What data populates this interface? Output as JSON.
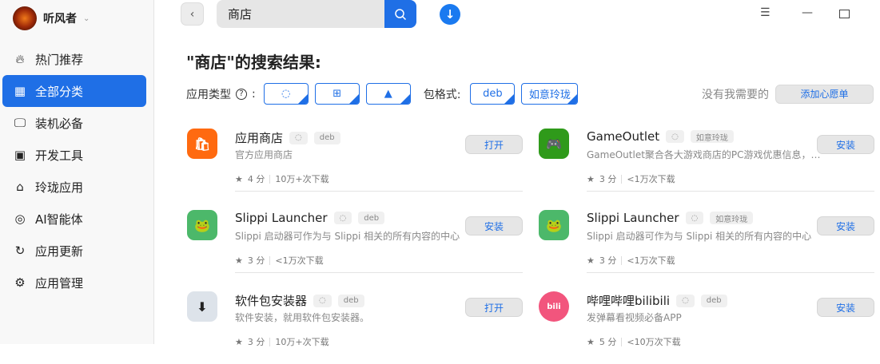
{
  "user": {
    "name": "听风者"
  },
  "sidebar": {
    "items": [
      {
        "label": "热门推荐",
        "icon": "fire-icon",
        "glyph": "🔥︎"
      },
      {
        "label": "全部分类",
        "icon": "grid-icon",
        "glyph": "▦",
        "active": true
      },
      {
        "label": "装机必备",
        "icon": "monitor-icon",
        "glyph": "🖵"
      },
      {
        "label": "开发工具",
        "icon": "terminal-icon",
        "glyph": "▣"
      },
      {
        "label": "玲珑应用",
        "icon": "linglong-icon",
        "glyph": "⌂"
      },
      {
        "label": "AI智能体",
        "icon": "ai-icon",
        "glyph": "◎"
      },
      {
        "label": "应用更新",
        "icon": "refresh-icon",
        "glyph": "↻"
      },
      {
        "label": "应用管理",
        "icon": "gear-icon",
        "glyph": "⚙"
      }
    ]
  },
  "search": {
    "value": "商店"
  },
  "heading": "\"商店\"的搜索结果:",
  "filters": {
    "type_label": "应用类型",
    "help": "?",
    "colon": ":",
    "format_label": "包格式:",
    "formats": [
      "deb",
      "如意玲珑"
    ],
    "wish_text": "没有我需要的",
    "wish_button": "添加心愿单"
  },
  "apps": [
    {
      "name": "应用商店",
      "tag": "deb",
      "desc": "官方应用商店",
      "rating": "4 分",
      "downloads": "10万+次下载",
      "button": "打开",
      "color": "#ff6a10",
      "glyph": "🛍"
    },
    {
      "name": "GameOutlet",
      "tag": "如意玲珑",
      "desc": "GameOutlet聚合各大游戏商店的PC游戏优惠信息，帮助玩家找到最优惠的价格",
      "rating": "3 分",
      "downloads": "<1万次下载",
      "button": "安装",
      "color": "#2f9a1a",
      "glyph": "🎮"
    },
    {
      "name": "Slippi Launcher",
      "tag": "deb",
      "desc": "Slippi 启动器可作为与 Slippi 相关的所有内容的中心",
      "rating": "3 分",
      "downloads": "<1万次下载",
      "button": "安装",
      "color": "#4cb86a",
      "glyph": "🐸"
    },
    {
      "name": "Slippi Launcher",
      "tag": "如意玲珑",
      "desc": "Slippi 启动器可作为与 Slippi 相关的所有内容的中心",
      "rating": "3 分",
      "downloads": "<1万次下载",
      "button": "安装",
      "color": "#4cb86a",
      "glyph": "🐸"
    },
    {
      "name": "软件包安装器",
      "tag": "deb",
      "desc": "软件安装，就用软件包安装器。",
      "rating": "3 分",
      "downloads": "10万+次下载",
      "button": "打开",
      "color": "#dde3ea",
      "glyph": "⬇"
    },
    {
      "name": "哔哩哔哩bilibili",
      "tag": "deb",
      "desc": "发弹幕看视频必备APP",
      "rating": "5 分",
      "downloads": "<10万次下载",
      "button": "安装",
      "color": "#f2557d",
      "glyph": "bili"
    }
  ]
}
